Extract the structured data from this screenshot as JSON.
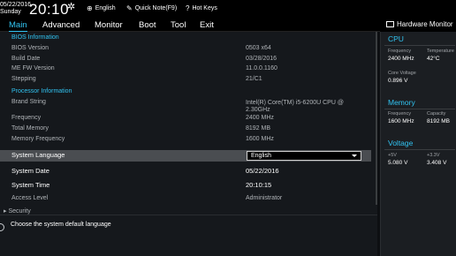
{
  "topbar": {
    "date": "05/22/2016",
    "day": "Sunday",
    "time": "20:10",
    "language": "English",
    "quick_note": "Quick Note(F9)",
    "hot_keys": "Hot Keys"
  },
  "menu": {
    "tabs": [
      "Main",
      "Advanced",
      "Monitor",
      "Boot",
      "Tool",
      "Exit"
    ],
    "active": "Main"
  },
  "main": {
    "bios_info_title": "BIOS Information",
    "bios_version": {
      "label": "BIOS Version",
      "value": "0503 x64"
    },
    "build_date": {
      "label": "Build Date",
      "value": "03/28/2016"
    },
    "me_fw": {
      "label": "ME FW Version",
      "value": "11.0.0.1160"
    },
    "stepping": {
      "label": "Stepping",
      "value": "21/C1"
    },
    "processor_title": "Processor Information",
    "brand_string": {
      "label": "Brand String",
      "value": "Intel(R) Core(TM) i5-6200U CPU @ 2.30GHz"
    },
    "frequency": {
      "label": "Frequency",
      "value": "2400 MHz"
    },
    "total_memory": {
      "label": "Total Memory",
      "value": "8192 MB"
    },
    "memory_frequency": {
      "label": "Memory Frequency",
      "value": "1600 MHz"
    },
    "system_language": {
      "label": "System Language",
      "value": "English"
    },
    "system_date": {
      "label": "System Date",
      "value": "05/22/2016"
    },
    "system_time": {
      "label": "System Time",
      "value": "20:10:15"
    },
    "access_level": {
      "label": "Access Level",
      "value": "Administrator"
    },
    "security": {
      "label": "Security"
    }
  },
  "help": {
    "text": "Choose the system default language"
  },
  "hardware_monitor": {
    "title": "Hardware Monitor",
    "cpu": {
      "title": "CPU",
      "frequency_label": "Frequency",
      "frequency_value": "2400 MHz",
      "temperature_label": "Temperature",
      "temperature_value": "42°C",
      "core_voltage_label": "Core Voltage",
      "core_voltage_value": "0.896 V"
    },
    "memory": {
      "title": "Memory",
      "frequency_label": "Frequency",
      "frequency_value": "1600 MHz",
      "capacity_label": "Capacity",
      "capacity_value": "8192 MB"
    },
    "voltage": {
      "title": "Voltage",
      "v5_label": "+5V",
      "v5_value": "5.080 V",
      "v33_label": "+3.3V",
      "v33_value": "3.408 V"
    }
  },
  "colors": {
    "accent": "#31c3f1",
    "background": "#15181c",
    "selected_row": "#4a4d51"
  }
}
